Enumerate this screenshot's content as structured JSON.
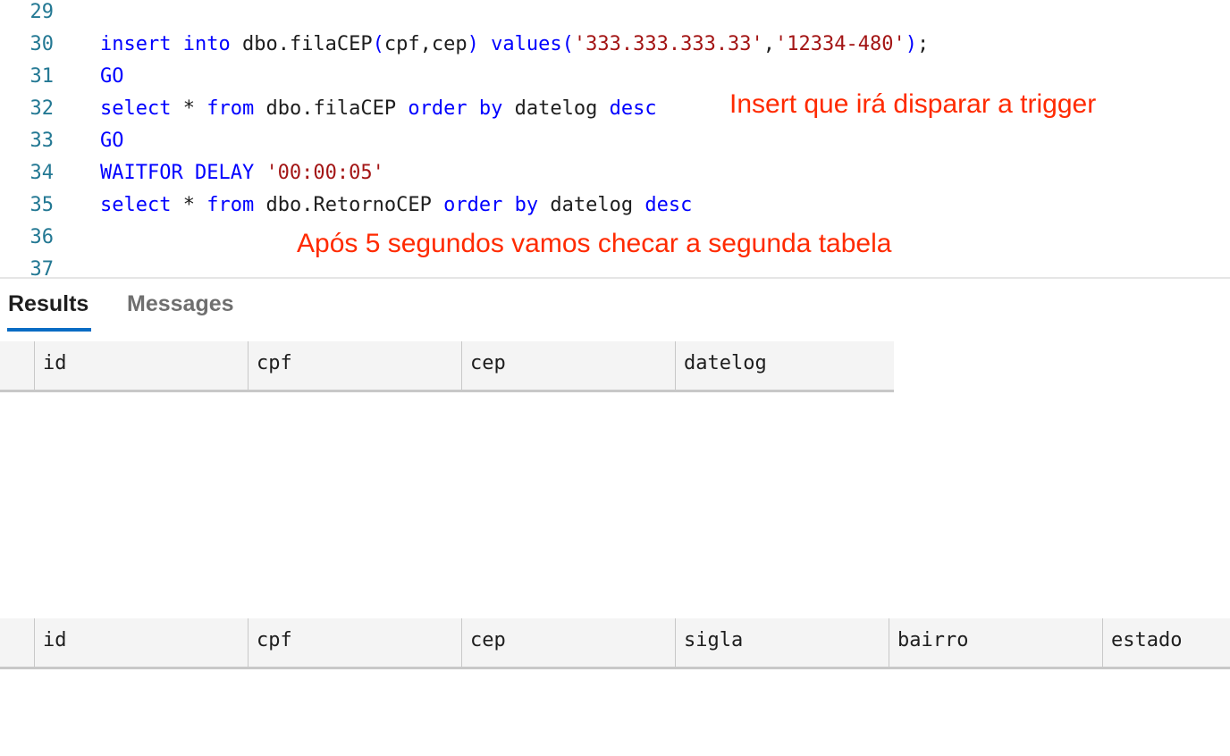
{
  "editor": {
    "lines": [
      {
        "number": "29",
        "tokens": []
      },
      {
        "number": "30",
        "tokens": [
          {
            "text": "insert",
            "cls": "kw"
          },
          {
            "text": " ",
            "cls": "plain"
          },
          {
            "text": "into",
            "cls": "kw"
          },
          {
            "text": " dbo.filaCEP",
            "cls": "plain"
          },
          {
            "text": "(",
            "cls": "kw"
          },
          {
            "text": "cpf,cep",
            "cls": "plain"
          },
          {
            "text": ")",
            "cls": "kw"
          },
          {
            "text": " ",
            "cls": "plain"
          },
          {
            "text": "values",
            "cls": "kw"
          },
          {
            "text": "(",
            "cls": "kw"
          },
          {
            "text": "'333.333.333.33'",
            "cls": "str"
          },
          {
            "text": ",",
            "cls": "plain"
          },
          {
            "text": "'12334-480'",
            "cls": "str"
          },
          {
            "text": ")",
            "cls": "kw"
          },
          {
            "text": ";",
            "cls": "plain"
          }
        ]
      },
      {
        "number": "31",
        "tokens": [
          {
            "text": "GO",
            "cls": "kw"
          }
        ]
      },
      {
        "number": "32",
        "tokens": [
          {
            "text": "select",
            "cls": "kw"
          },
          {
            "text": " * ",
            "cls": "plain"
          },
          {
            "text": "from",
            "cls": "kw"
          },
          {
            "text": " dbo.filaCEP ",
            "cls": "plain"
          },
          {
            "text": "order by",
            "cls": "kw"
          },
          {
            "text": " datelog ",
            "cls": "plain"
          },
          {
            "text": "desc",
            "cls": "kw"
          }
        ]
      },
      {
        "number": "33",
        "tokens": [
          {
            "text": "GO",
            "cls": "kw"
          }
        ]
      },
      {
        "number": "34",
        "tokens": [
          {
            "text": "WAITFOR DELAY",
            "cls": "kw"
          },
          {
            "text": " ",
            "cls": "plain"
          },
          {
            "text": "'00:00:05'",
            "cls": "str"
          }
        ]
      },
      {
        "number": "35",
        "tokens": [
          {
            "text": "select",
            "cls": "kw"
          },
          {
            "text": " * ",
            "cls": "plain"
          },
          {
            "text": "from",
            "cls": "kw"
          },
          {
            "text": " dbo.RetornoCEP ",
            "cls": "plain"
          },
          {
            "text": "order by",
            "cls": "kw"
          },
          {
            "text": " datelog ",
            "cls": "plain"
          },
          {
            "text": "desc",
            "cls": "kw"
          }
        ]
      },
      {
        "number": "36",
        "tokens": []
      },
      {
        "number": "37",
        "tokens": []
      }
    ],
    "annotations": {
      "insert_note": "Insert que irá disparar a trigger",
      "wait_note": "Após 5 segundos vamos checar a segunda tabela"
    },
    "colors": {
      "keyword": "#0000ff",
      "string": "#a31515",
      "line_number": "#237893",
      "annotation": "#ff2a00"
    }
  },
  "results": {
    "tabs": {
      "results_label": "Results",
      "messages_label": "Messages"
    },
    "grid1_columns": [
      "id",
      "cpf",
      "cep",
      "datelog"
    ],
    "grid2_columns": [
      "id",
      "cpf",
      "cep",
      "sigla",
      "bairro",
      "estado"
    ],
    "accent_color": "#0a6cc4"
  }
}
